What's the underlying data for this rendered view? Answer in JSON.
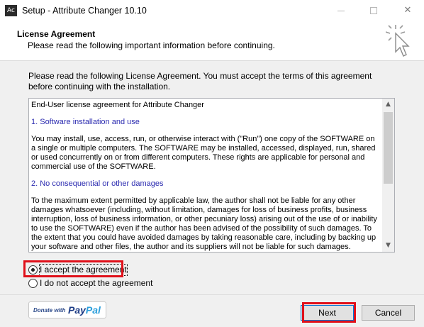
{
  "window": {
    "icon_text": "Ac",
    "title": "Setup - Attribute Changer 10.10",
    "minimize_icon": "minimize-icon",
    "maximize_icon": "maximize-icon",
    "close_glyph": "✕"
  },
  "header": {
    "title": "License Agreement",
    "subtitle": "Please read the following important information before continuing.",
    "icon": "wizard-cursor-icon"
  },
  "intro_text": "Please read the following License Agreement. You must accept the terms of this agreement before continuing with the installation.",
  "license": {
    "paragraphs": [
      {
        "text": "End-User license agreement for Attribute Changer",
        "kind": "body"
      },
      {
        "text": "1. Software installation and use",
        "kind": "section"
      },
      {
        "text": "You may install, use, access, run, or otherwise interact with (\"Run\") one copy of the SOFTWARE on a single or multiple computers. The SOFTWARE may be installed, accessed, displayed, run, shared or used concurrently on or from different computers. These rights are applicable for personal and commercial use of the SOFTWARE.",
        "kind": "body"
      },
      {
        "text": "2. No consequential or other damages",
        "kind": "section"
      },
      {
        "text": "To the maximum extent permitted by applicable law, the author shall not be liable for any other damages whatsoever (including, without limitation, damages for loss of business profits, business interruption, loss of business information, or other pecuniary loss) arising out of the use of or inability to use the SOFTWARE) even if the author has been advised of the possibility of such damages. To the extent that you could have avoided damages by taking reasonable care, including by backing up your software and other files, the author and its suppliers will not be liable for such damages.",
        "kind": "body"
      }
    ],
    "scroll_up_glyph": "▲",
    "scroll_down_glyph": "▼"
  },
  "options": {
    "accept_label": "I accept the agreement",
    "decline_label": "I do not accept the agreement",
    "selected": "accept"
  },
  "donate": {
    "small_text": "Donate with",
    "pay": "Pay",
    "pal": "Pal",
    "colors": {
      "pay": "#1c3b85",
      "pal": "#2b9fdc"
    }
  },
  "buttons": {
    "next": "Next",
    "cancel": "Cancel"
  },
  "highlight_color": "#e0101a"
}
